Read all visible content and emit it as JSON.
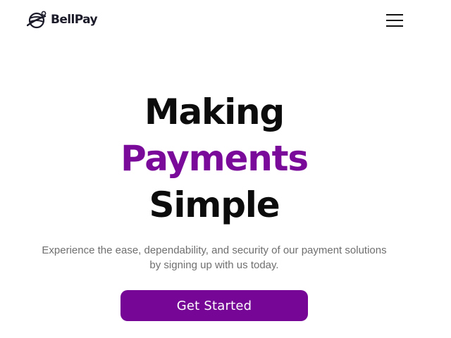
{
  "brand": {
    "name": "BellPay",
    "icon": "globe-swoosh-logo-icon"
  },
  "header": {
    "menu_icon": "hamburger-menu-icon"
  },
  "hero": {
    "title_line1": "Making",
    "title_line2": "Payments",
    "title_line3": "Simple",
    "subtitle": "Experience the ease, dependability, and security of our payment solutions by signing up with us today.",
    "cta_label": "Get Started"
  },
  "colors": {
    "accent": "#7a0a99",
    "button": "#760696",
    "text_dark": "#0c0c0c",
    "text_muted": "#6f6f6f",
    "background": "#ffffff"
  }
}
